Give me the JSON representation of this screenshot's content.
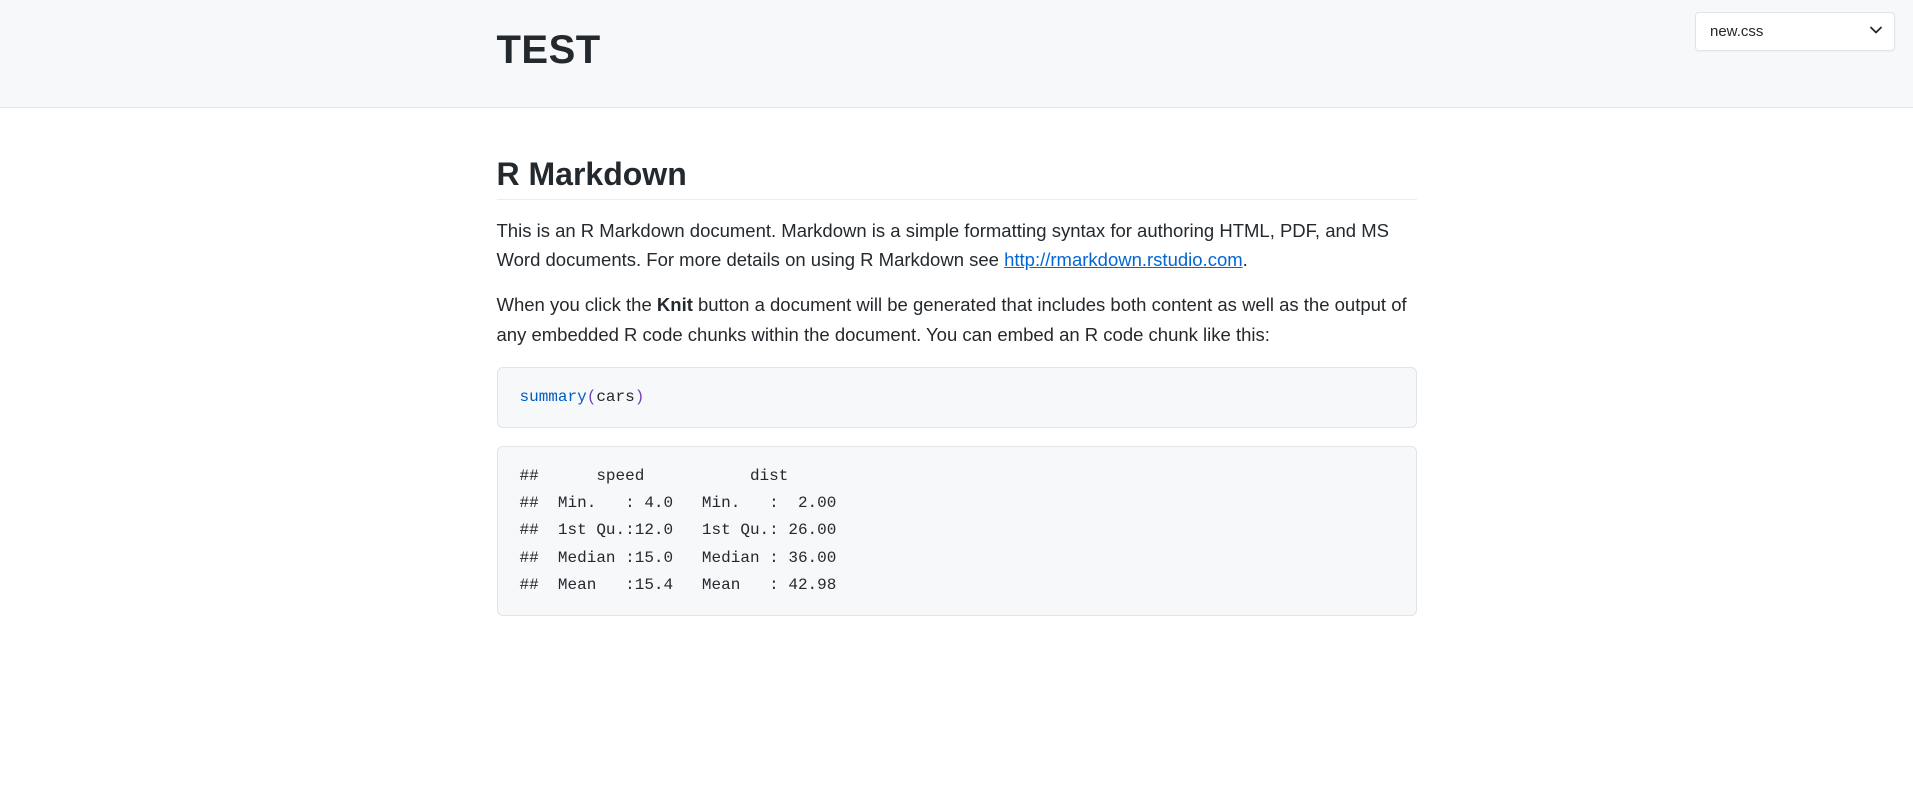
{
  "header": {
    "title": "TEST",
    "css_selector_value": "new.css"
  },
  "section": {
    "heading": "R Markdown",
    "p1_a": "This is an R Markdown document. Markdown is a simple formatting syntax for authoring HTML, PDF, and MS Word documents. For more details on using R Markdown see ",
    "p1_link_text": "http://rmarkdown.rstudio.com",
    "p1_b": ".",
    "p2_a": "When you click the ",
    "p2_strong": "Knit",
    "p2_b": " button a document will be generated that includes both content as well as the output of any embedded R code chunks within the document. You can embed an R code chunk like this:"
  },
  "code": {
    "fn": "summary",
    "open": "(",
    "arg": "cars",
    "close": ")"
  },
  "output": "##      speed           dist       \n##  Min.   : 4.0   Min.   :  2.00  \n##  1st Qu.:12.0   1st Qu.: 26.00  \n##  Median :15.0   Median : 36.00  \n##  Mean   :15.4   Mean   : 42.98  "
}
